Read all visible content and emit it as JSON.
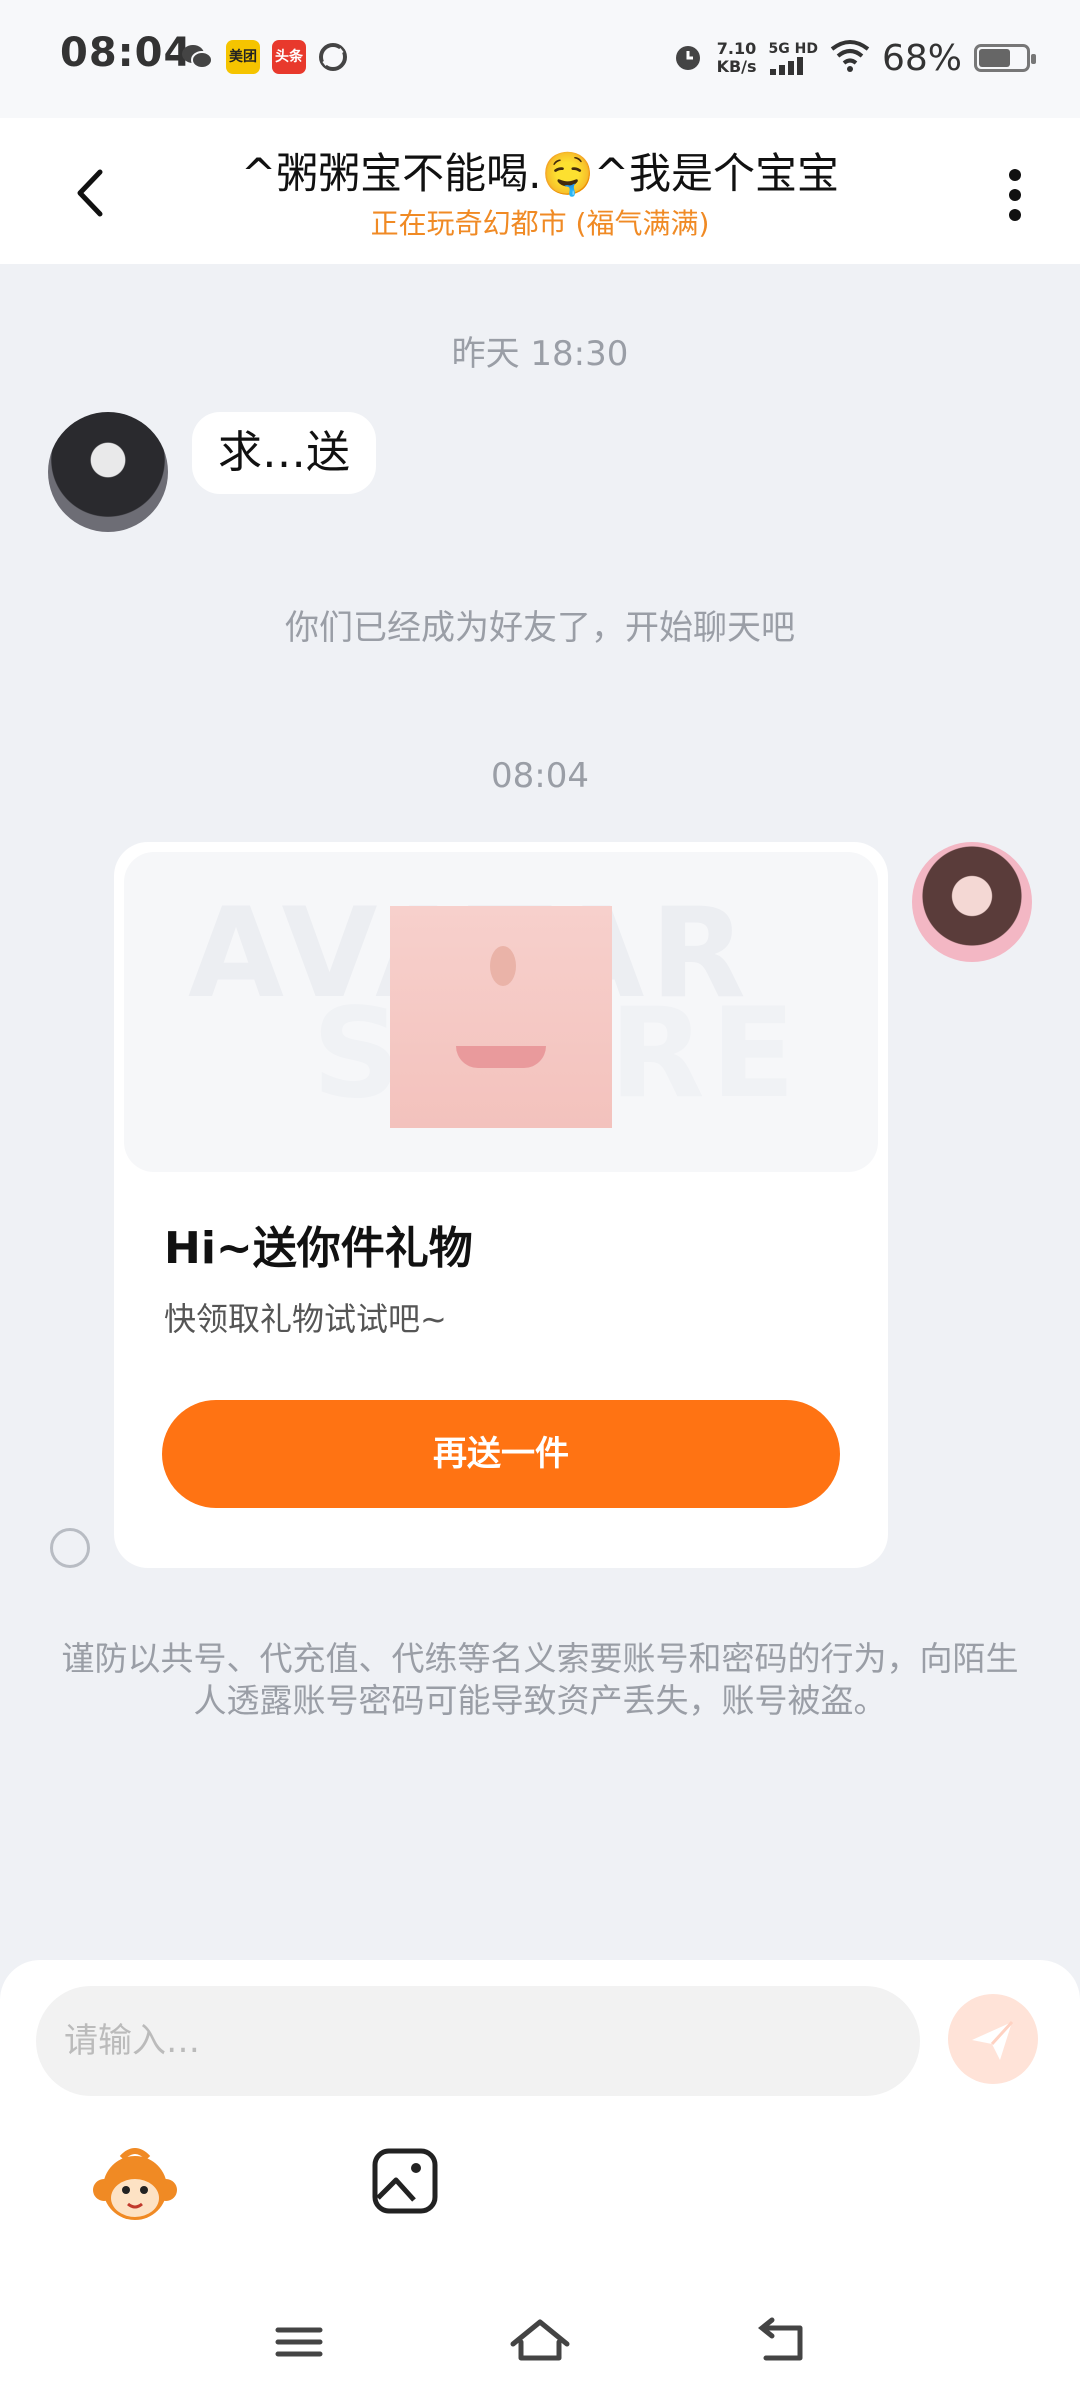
{
  "status_bar": {
    "time": "08:04",
    "speed_value": "7.10",
    "speed_unit": "KB/s",
    "network": "5G HD",
    "battery": "68%",
    "battery_level": 0.68,
    "apps": [
      "wechat-icon",
      "meituan-icon",
      "toutiao-icon",
      "loop-icon"
    ],
    "meituan_label": "美团",
    "toutiao_label": "头条"
  },
  "header": {
    "title": "^粥粥宝不能喝.🤤^我是个宝宝",
    "subtitle": "正在玩奇幻都市 (福气满满)"
  },
  "chat": {
    "timestamp_1": "昨天 18:30",
    "message_1": "求…送",
    "system_note": "你们已经成为好友了，开始聊天吧",
    "timestamp_2": "08:04",
    "gift_card": {
      "watermark_1": "AVATAR",
      "watermark_2": "STORE",
      "title": "Hi~送你件礼物",
      "description": "快领取礼物试试吧~",
      "button_label": "再送一件",
      "accent_color": "#ff7313"
    },
    "warning": "谨防以共号、代充值、代练等名义索要账号和密码的行为，向陌生人透露账号密码可能导致资产丢失，账号被盗。"
  },
  "input": {
    "placeholder": "请输入…"
  }
}
